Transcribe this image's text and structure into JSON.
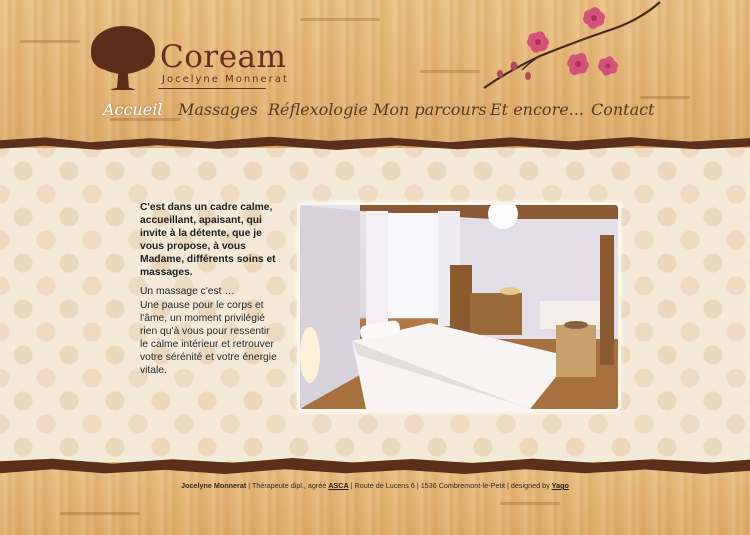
{
  "logo": {
    "title": "Coream",
    "subtitle": "Jocelyne Monnerat"
  },
  "nav": [
    {
      "label": "Accueil",
      "active": true
    },
    {
      "label": "Massages"
    },
    {
      "label": "Réflexologie"
    },
    {
      "label": "Mon parcours"
    },
    {
      "label": "Et encore..."
    },
    {
      "label": "Contact"
    }
  ],
  "content": {
    "intro": "C'est dans un cadre calme, accueillant, apaisant, qui invite à la détente, que je vous propose, à vous Madame, différents soins et massages.",
    "massage_heading": "Un massage c'est …",
    "massage_text": "Une pause pour le corps et l'âme, un moment privilégié rien qu'à vous pour ressentir le calme intérieur et retrouver votre sérénité et votre énergie vitale."
  },
  "footer": {
    "name": "Jocelyne Monnerat",
    "role": "Thérapeute dipl., agréé",
    "asca": "ASCA",
    "address": "Route de Lucens 6 | 1536 Combremont-le-Petit | designed by",
    "designer": "Yago",
    "separator": " | "
  },
  "colors": {
    "brand_brown": "#6a2e1c",
    "nav_text": "#5a3a22",
    "cream": "#f4ead8",
    "wood": "#e6b979"
  }
}
